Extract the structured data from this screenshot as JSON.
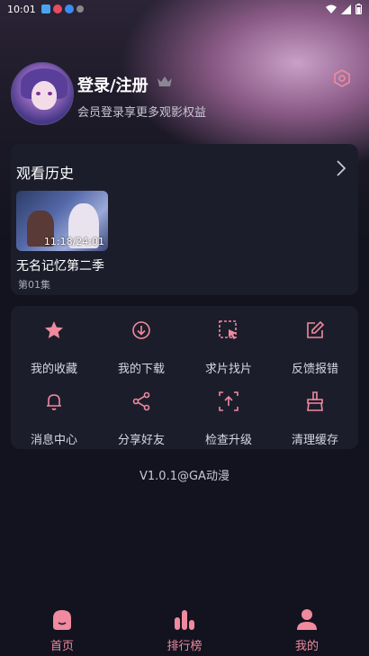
{
  "status_bar": {
    "time": "10:01"
  },
  "profile": {
    "login_title": "登录/注册",
    "subtitle": "会员登录享更多观影权益"
  },
  "history": {
    "title": "观看历史",
    "items": [
      {
        "title": "无名记忆第二季",
        "episode": "第01集",
        "progress": "11:18/24:01"
      }
    ]
  },
  "menu": {
    "items": [
      {
        "label": "我的收藏",
        "icon": "star-icon"
      },
      {
        "label": "我的下载",
        "icon": "download-icon"
      },
      {
        "label": "求片找片",
        "icon": "select-pointer-icon"
      },
      {
        "label": "反馈报错",
        "icon": "edit-icon"
      },
      {
        "label": "消息中心",
        "icon": "bell-icon"
      },
      {
        "label": "分享好友",
        "icon": "share-icon"
      },
      {
        "label": "检查升级",
        "icon": "upgrade-icon"
      },
      {
        "label": "清理缓存",
        "icon": "broom-icon"
      }
    ]
  },
  "version": "V1.0.1@GA动漫",
  "tabbar": {
    "items": [
      {
        "label": "首页",
        "icon": "home-icon"
      },
      {
        "label": "排行榜",
        "icon": "bar-chart-icon"
      },
      {
        "label": "我的",
        "icon": "user-icon"
      }
    ]
  },
  "colors": {
    "accent": "#f08a9e",
    "background": "#12131f",
    "card": "#1c1d2b"
  }
}
